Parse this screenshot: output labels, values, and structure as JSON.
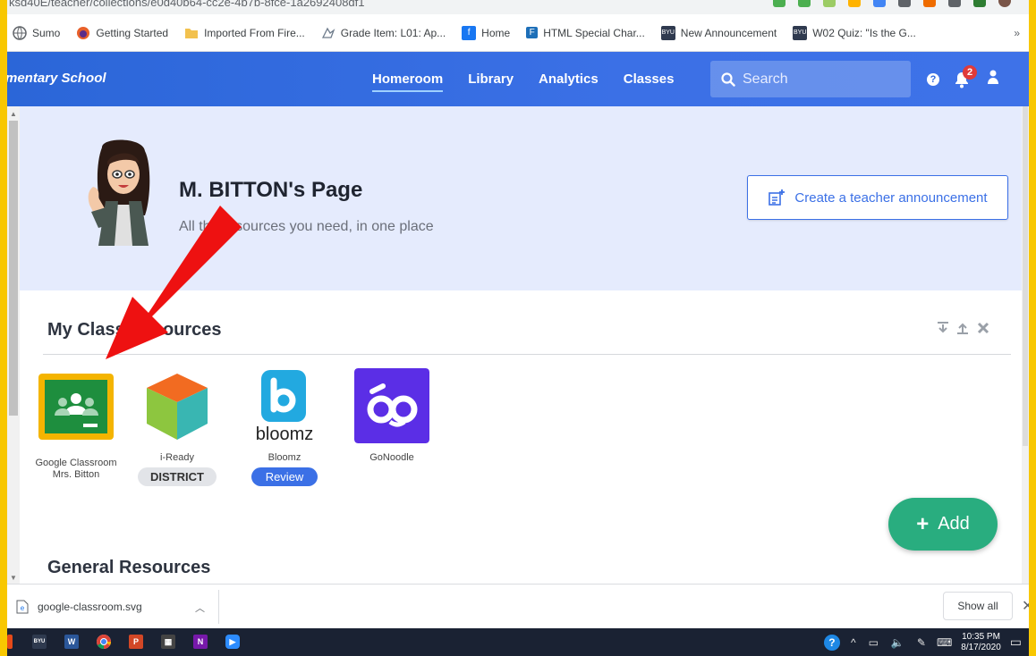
{
  "browser": {
    "url": "ksd40E/teacher/collections/e0d40b64-cc2e-4b7b-8fce-1a2692408df1",
    "bookmarks": [
      {
        "label": "Sumo",
        "icon": "globe-icon",
        "color": "#5f6368"
      },
      {
        "label": "Getting Started",
        "icon": "firefox-icon",
        "color": "#e8602a"
      },
      {
        "label": "Imported From Fire...",
        "icon": "folder-icon",
        "color": "#f2c14e"
      },
      {
        "label": "Grade Item: L01: Ap...",
        "icon": "edu-icon",
        "color": "#6e7b8b"
      },
      {
        "label": "Home",
        "icon": "facebook-icon",
        "color": "#1877f2"
      },
      {
        "label": "HTML Special Char...",
        "icon": "f-icon",
        "color": "#1d6fb8"
      },
      {
        "label": "New Announcement",
        "icon": "byu-icon",
        "color": "#2f3a4f"
      },
      {
        "label": "W02 Quiz: \"Is the G...",
        "icon": "byu-icon",
        "color": "#2f3a4f"
      }
    ],
    "bookmarks_more": "»"
  },
  "nav": {
    "brand": "mentary School",
    "links": [
      {
        "label": "Homeroom",
        "active": true
      },
      {
        "label": "Library",
        "active": false
      },
      {
        "label": "Analytics",
        "active": false
      },
      {
        "label": "Classes",
        "active": false
      }
    ],
    "search_placeholder": "Search",
    "help": "?",
    "notification_count": "2"
  },
  "hero": {
    "title": "M. BITTON's Page",
    "subtitle": "All the resources you need, in one place",
    "announce_label": "Create a teacher announcement"
  },
  "my_class_resources": {
    "title": "My Class Resources",
    "items": [
      {
        "name": "Google Classroom Mrs. Bitton",
        "badge": "",
        "icon": "google-classroom-icon"
      },
      {
        "name": "i-Ready",
        "badge": "DISTRICT",
        "icon": "i-ready-icon"
      },
      {
        "name": "Bloomz",
        "badge": "Review",
        "icon": "bloomz-icon"
      },
      {
        "name": "GoNoodle",
        "badge": "",
        "icon": "gonoodle-icon"
      }
    ]
  },
  "general_resources": {
    "title": "General Resources"
  },
  "add_button": "Add",
  "download": {
    "filename": "google-classroom.svg",
    "show_all": "Show all"
  },
  "taskbar": {
    "time": "10:35 PM",
    "date": "8/17/2020"
  },
  "colors": {
    "nav_blue": "#3b70e6",
    "hero_bg": "#e5ebfd",
    "add_green": "#29ad7f",
    "arrow_red": "#ee1111",
    "frame_yellow": "#f8c700"
  }
}
